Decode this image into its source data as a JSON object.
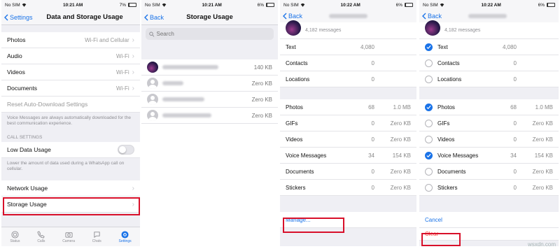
{
  "status": {
    "carrier": "No SIM",
    "screens": [
      {
        "time": "10:21 AM",
        "battery": "7%",
        "battery_level": 0.07
      },
      {
        "time": "10:21 AM",
        "battery": "6%",
        "battery_level": 0.06
      },
      {
        "time": "10:22 AM",
        "battery": "6%",
        "battery_level": 0.06
      },
      {
        "time": "10:22 AM",
        "battery": "6%",
        "battery_level": 0.06
      }
    ]
  },
  "screen1": {
    "back_label": "Settings",
    "title": "Data and Storage Usage",
    "media_rows": [
      {
        "label": "Photos",
        "value": "Wi-Fi and Cellular"
      },
      {
        "label": "Audio",
        "value": "Wi-Fi"
      },
      {
        "label": "Videos",
        "value": "Wi-Fi"
      },
      {
        "label": "Documents",
        "value": "Wi-Fi"
      }
    ],
    "reset_label": "Reset Auto-Download Settings",
    "voice_note": "Voice Messages are always automatically downloaded for the best communication experience.",
    "call_settings_header": "CALL SETTINGS",
    "low_data_label": "Low Data Usage",
    "low_data_enabled": false,
    "low_data_note": "Lower the amount of data used during a WhatsApp call on cellular.",
    "network_usage_label": "Network Usage",
    "storage_usage_label": "Storage Usage",
    "tabs": [
      {
        "label": "Status",
        "icon": "status-icon",
        "active": false
      },
      {
        "label": "Calls",
        "icon": "phone-icon",
        "active": false
      },
      {
        "label": "Camera",
        "icon": "camera-icon",
        "active": false
      },
      {
        "label": "Chats",
        "icon": "chat-icon",
        "active": false
      },
      {
        "label": "Settings",
        "icon": "gear-icon",
        "active": true
      }
    ]
  },
  "screen2": {
    "back_label": "Back",
    "title": "Storage Usage",
    "search_placeholder": "Search",
    "chats": [
      {
        "size": "140 KB",
        "avatar": "photo"
      },
      {
        "size": "Zero KB",
        "avatar": "generic"
      },
      {
        "size": "Zero KB",
        "avatar": "generic"
      },
      {
        "size": "Zero KB",
        "avatar": "generic"
      }
    ]
  },
  "screen3": {
    "back_label": "Back",
    "messages_count": "4,182 messages",
    "text_rows": [
      {
        "label": "Text",
        "count": "4,080"
      },
      {
        "label": "Contacts",
        "count": "0"
      },
      {
        "label": "Locations",
        "count": "0"
      }
    ],
    "media_rows": [
      {
        "label": "Photos",
        "count": "68",
        "size": "1.0 MB"
      },
      {
        "label": "GIFs",
        "count": "0",
        "size": "Zero KB"
      },
      {
        "label": "Videos",
        "count": "0",
        "size": "Zero KB"
      },
      {
        "label": "Voice Messages",
        "count": "34",
        "size": "154 KB"
      },
      {
        "label": "Documents",
        "count": "0",
        "size": "Zero KB"
      },
      {
        "label": "Stickers",
        "count": "0",
        "size": "Zero KB"
      }
    ],
    "manage_label": "Manage..."
  },
  "screen4": {
    "back_label": "Back",
    "messages_count": "4,182 messages",
    "text_rows": [
      {
        "label": "Text",
        "count": "4,080",
        "checked": true
      },
      {
        "label": "Contacts",
        "count": "0",
        "checked": false
      },
      {
        "label": "Locations",
        "count": "0",
        "checked": false
      }
    ],
    "media_rows": [
      {
        "label": "Photos",
        "count": "68",
        "size": "1.0 MB",
        "checked": true
      },
      {
        "label": "GIFs",
        "count": "0",
        "size": "Zero KB",
        "checked": false
      },
      {
        "label": "Videos",
        "count": "0",
        "size": "Zero KB",
        "checked": false
      },
      {
        "label": "Voice Messages",
        "count": "34",
        "size": "154 KB",
        "checked": true
      },
      {
        "label": "Documents",
        "count": "0",
        "size": "Zero KB",
        "checked": false
      },
      {
        "label": "Stickers",
        "count": "0",
        "size": "Zero KB",
        "checked": false
      }
    ],
    "cancel_label": "Cancel",
    "clear_label": "Clear"
  },
  "watermark": "wsxdn.com",
  "colors": {
    "accent": "#1a73e8",
    "highlight_box": "#d8102a",
    "destructive": "#ff3b30"
  }
}
